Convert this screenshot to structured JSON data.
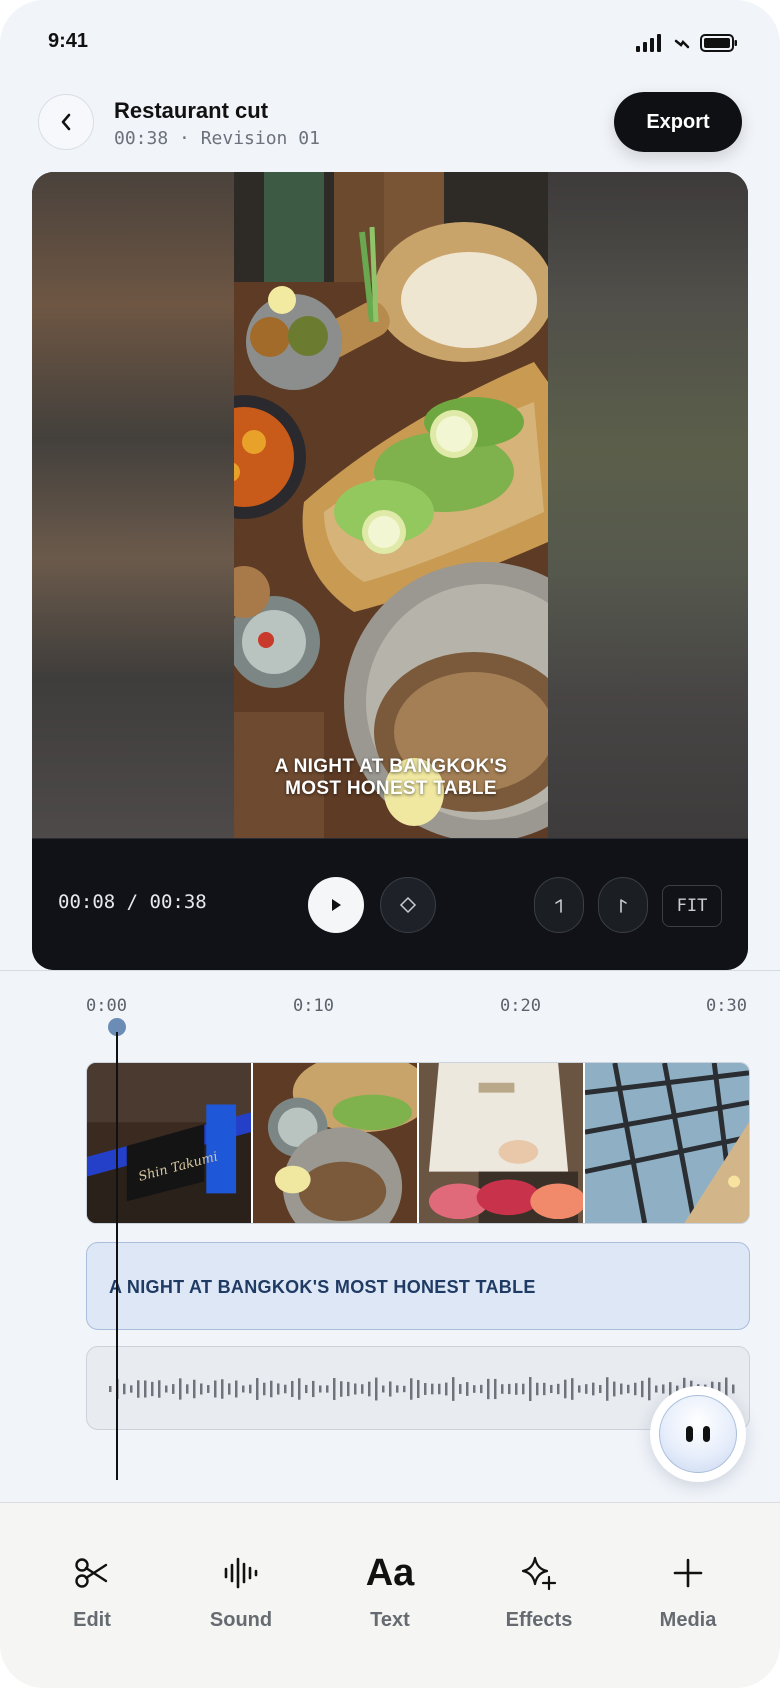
{
  "status": {
    "time": "9:41"
  },
  "header": {
    "title": "Restaurant cut",
    "subtitle": "00:38 · Revision 01",
    "export_label": "Export"
  },
  "preview": {
    "caption_line1": "A NIGHT AT BANGKOK'S",
    "caption_line2": "MOST HONEST TABLE",
    "timecode": "00:08 / 00:38",
    "fit_label": "FIT"
  },
  "timeline": {
    "ticks": [
      "0:00",
      "0:10",
      "0:20",
      "0:30"
    ],
    "text_track_label": "A NIGHT AT BANGKOK'S MOST HONEST TABLE",
    "clips": [
      {
        "name": "restaurant-sign-clip",
        "sign_text": "Shin Takumi"
      },
      {
        "name": "thai-dishes-clip"
      },
      {
        "name": "chef-sashimi-clip"
      },
      {
        "name": "glass-ceiling-clip"
      }
    ]
  },
  "toolbar": {
    "tools": [
      {
        "label": "Edit",
        "icon": "scissors-icon"
      },
      {
        "label": "Sound",
        "icon": "waveform-icon"
      },
      {
        "label": "Text",
        "icon": "text-aa-icon",
        "glyph": "Aa"
      },
      {
        "label": "Effects",
        "icon": "sparkle-icon"
      },
      {
        "label": "Media",
        "icon": "plus-icon"
      }
    ]
  },
  "colors": {
    "accent": "#6b8cb5",
    "text_track_bg": "#dde7f5",
    "text_track_label": "#1f3b64",
    "export_bg": "#0e1014"
  }
}
